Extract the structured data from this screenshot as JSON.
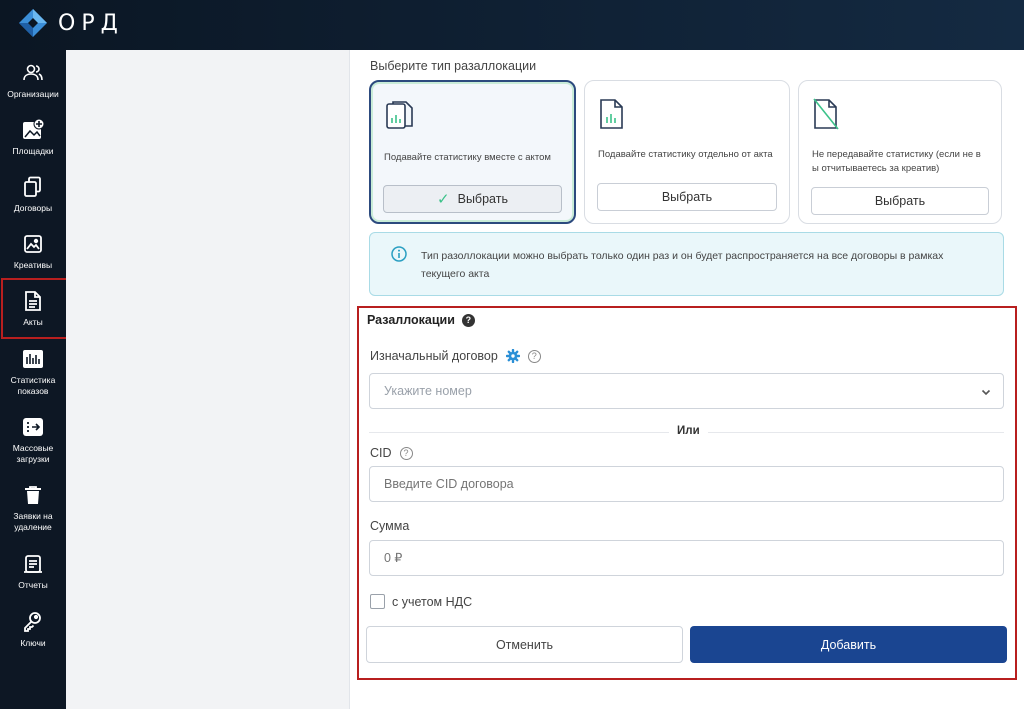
{
  "app": {
    "logo_text": "ОРД"
  },
  "sidebar": {
    "items": [
      {
        "label": "Организации",
        "icon": "users-icon"
      },
      {
        "label": "Площадки",
        "icon": "add-site-icon"
      },
      {
        "label": "Договоры",
        "icon": "copy-docs-icon"
      },
      {
        "label": "Креативы",
        "icon": "image-icon"
      },
      {
        "label": "Акты",
        "icon": "document-icon",
        "active": true
      },
      {
        "label": "Статистика показов",
        "icon": "stats-icon"
      },
      {
        "label": "Массовые загрузки",
        "icon": "bulk-upload-icon"
      },
      {
        "label": "Заявки на удаление",
        "icon": "trash-icon"
      },
      {
        "label": "Отчеты",
        "icon": "report-icon"
      },
      {
        "label": "Ключи",
        "icon": "key-icon"
      }
    ]
  },
  "allocation_type": {
    "label": "Выберите тип разаллокации",
    "cards": [
      {
        "text": "Подавайте статистику вместе с актом",
        "button": "Выбрать",
        "selected": true
      },
      {
        "text": "Подавайте статистику отдельно от акта",
        "button": "Выбрать",
        "selected": false
      },
      {
        "text": "Не передавайте статистику (если не в ы отчитываетесь за креатив)",
        "button": "Выбрать",
        "selected": false
      }
    ]
  },
  "info": {
    "text": "Тип разоллокации можно выбрать только один раз и он будет распространяется на все договоры в рамках текущего акта"
  },
  "form": {
    "title": "Разаллокации",
    "contract_label": "Изначальный договор",
    "contract_placeholder": "Укажите номер",
    "or_text": "Или",
    "cid_label": "CID",
    "cid_placeholder": "Введите CID договора",
    "sum_label": "Сумма",
    "sum_placeholder": "0 ₽",
    "vat_label": "с учетом НДС",
    "vat_checked": false,
    "cancel_button": "Отменить",
    "add_button": "Добавить"
  },
  "colors": {
    "primary": "#1a4591",
    "highlight_border": "#b81f1f",
    "sidebar_bg": "#0d1724",
    "info_bg": "#eaf7fa",
    "icon_accent": "#2a8fd6"
  }
}
